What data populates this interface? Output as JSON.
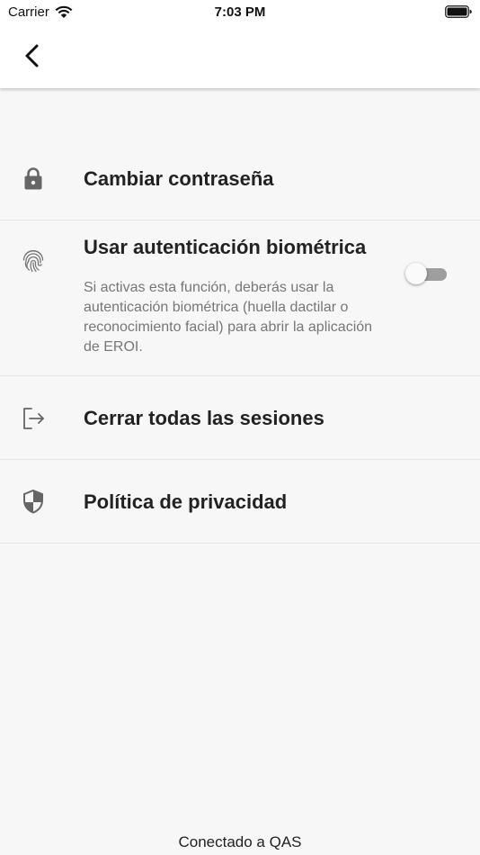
{
  "status_bar": {
    "carrier": "Carrier",
    "time": "7:03 PM"
  },
  "nav": {
    "back_icon": "chevron-left-icon"
  },
  "settings": {
    "items": [
      {
        "icon": "lock-icon",
        "title": "Cambiar contraseña"
      },
      {
        "icon": "fingerprint-icon",
        "title": "Usar autenticación biométrica",
        "description": "Si activas esta función, deberás usar la autenticación biométrica (huella dactilar o reconocimiento facial) para abrir la aplicación de EROI.",
        "toggle_on": false
      },
      {
        "icon": "logout-icon",
        "title": "Cerrar todas las sesiones"
      },
      {
        "icon": "shield-icon",
        "title": "Política de privacidad"
      }
    ]
  },
  "footer": {
    "connection": "Conectado a QAS"
  },
  "colors": {
    "background": "#f7f7f7",
    "header": "#ffffff",
    "title_text": "#222222",
    "description_text": "#777777",
    "icon": "#666666",
    "toggle_off_track": "#9e9e9e"
  }
}
